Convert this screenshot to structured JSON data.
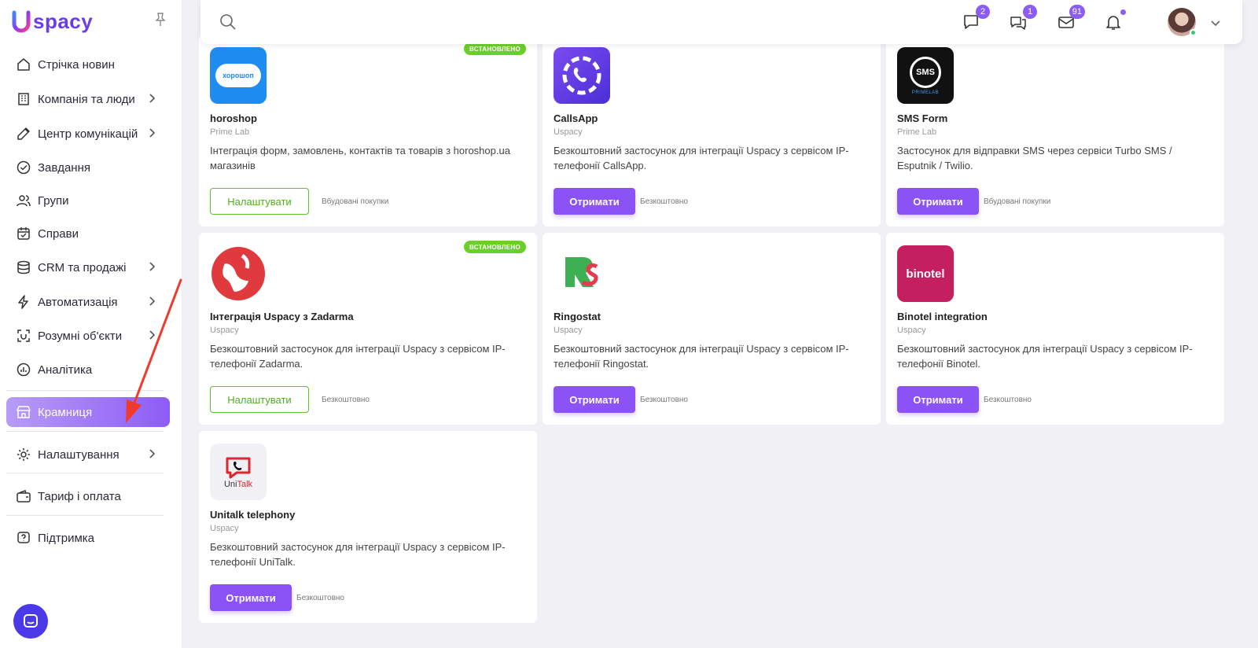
{
  "app": {
    "logo_text": "spacy",
    "logo_mark": "U"
  },
  "sidebar": {
    "items": [
      {
        "label": "Стрічка новин",
        "icon": "home-icon",
        "chevron": false
      },
      {
        "label": "Компанія та люди",
        "icon": "building-icon",
        "chevron": true
      },
      {
        "label": "Центр комунікацій",
        "icon": "edit-icon",
        "chevron": true
      },
      {
        "label": "Завдання",
        "icon": "check-circle-icon",
        "chevron": false
      },
      {
        "label": "Групи",
        "icon": "users-icon",
        "chevron": false
      },
      {
        "label": "Справи",
        "icon": "calendar-icon",
        "chevron": false
      },
      {
        "label": "CRM та продажі",
        "icon": "database-icon",
        "chevron": true
      },
      {
        "label": "Автоматизація",
        "icon": "bolt-icon",
        "chevron": true
      },
      {
        "label": "Розумні об'єкти",
        "icon": "smart-object-icon",
        "chevron": true
      },
      {
        "label": "Аналітика",
        "icon": "chart-icon",
        "chevron": false
      },
      {
        "label": "Крамниця",
        "icon": "store-icon",
        "chevron": false,
        "active": true
      },
      {
        "label": "Налаштування",
        "icon": "gear-icon",
        "chevron": true
      },
      {
        "label": "Тариф і оплата",
        "icon": "wallet-icon",
        "chevron": false
      },
      {
        "label": "Підтримка",
        "icon": "help-icon",
        "chevron": false
      }
    ]
  },
  "topbar": {
    "chat_badge": "2",
    "messages_badge": "1",
    "mail_badge": "91",
    "notifications_dot": true
  },
  "cards": [
    {
      "name": "horoshop",
      "vendor": "Prime Lab",
      "description": "Інтеграція форм, замовлень, контактів та товарів з horoshop.ua магазинів",
      "installed": true,
      "installed_label": "ВСТАНОВЛЕНО",
      "button": "Налаштувати",
      "button_style": "outline",
      "price": "Вбудовані покупки",
      "icon_text": "хорошоп"
    },
    {
      "name": "CallsApp",
      "vendor": "Uspacy",
      "description": "Безкоштовний застосунок для інтеграції Uspacy з сервісом IP-телефонії CallsApp.",
      "installed": false,
      "button": "Отримати",
      "button_style": "primary",
      "price": "Безкоштовно"
    },
    {
      "name": "SMS Form",
      "vendor": "Prime Lab",
      "description": "Застосунок для відправки SMS через сервіси Turbo SMS / Esputnik / Twilio.",
      "installed": false,
      "button": "Отримати",
      "button_style": "primary",
      "price": "Вбудовані покупки",
      "icon_text": "SMS",
      "icon_subtext": "PRIMELAB"
    },
    {
      "name": "Інтеграція Uspacy з Zadarma",
      "vendor": "Uspacy",
      "description": "Безкоштовний застосунок для інтеграції Uspacy з сервісом IP-телефонії Zadarma.",
      "installed": true,
      "installed_label": "ВСТАНОВЛЕНО",
      "button": "Налаштувати",
      "button_style": "outline",
      "price": "Безкоштовно"
    },
    {
      "name": "Ringostat",
      "vendor": "Uspacy",
      "description": "Безкоштовний застосунок для інтеграції Uspacy з сервісом IP-телефонії Ringostat.",
      "installed": false,
      "button": "Отримати",
      "button_style": "primary",
      "price": "Безкоштовно"
    },
    {
      "name": "Binotel integration",
      "vendor": "Uspacy",
      "description": "Безкоштовний застосунок для інтеграції Uspacy з сервісом IP-телефонії Binotel.",
      "installed": false,
      "button": "Отримати",
      "button_style": "primary",
      "price": "Безкоштовно",
      "icon_text": "binotel"
    },
    {
      "name": "Unitalk telephony",
      "vendor": "Uspacy",
      "description": "Безкоштовний застосунок для інтеграції Uspacy з сервісом IP-телефонії UniTalk.",
      "installed": false,
      "button": "Отримати",
      "button_style": "primary",
      "price": "Безкоштовно",
      "icon_text": "Uni",
      "icon_text_accent": "Talk"
    }
  ],
  "colors": {
    "accent": "#8b52f6",
    "installed": "#6bcf2a",
    "annotation_arrow": "#f03a2e"
  }
}
